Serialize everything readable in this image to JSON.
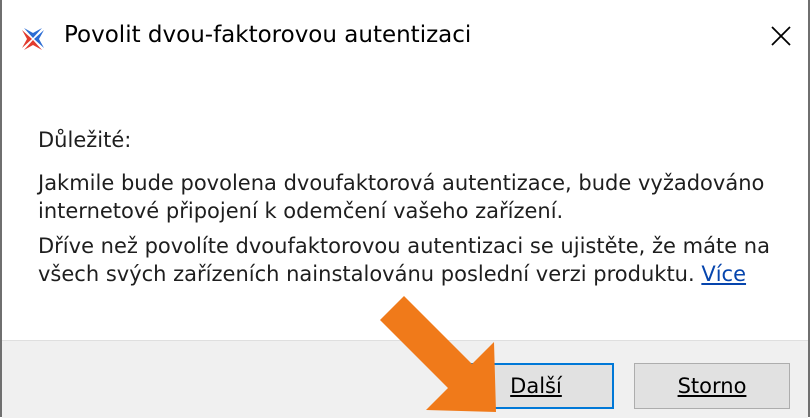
{
  "dialog": {
    "title": "Povolit dvou-faktorovou autentizaci",
    "app_icon": "app-logo-icon",
    "close_glyph": "✕"
  },
  "content": {
    "heading": "Důležité:",
    "paragraph1_line1": "Jakmile bude povolena dvoufaktorová autentizace, bude vyžadováno",
    "paragraph1_line2": "internetové připojení k odemčení vašeho zařízení.",
    "paragraph2_line1": "Dříve než povolíte dvoufaktorovou autentizaci se ujistěte, že máte na",
    "paragraph2_line2": "všech svých zařízeních nainstalovánu poslední verzi produktu.",
    "more_link": "Více"
  },
  "buttons": {
    "next_label": "Další",
    "cancel_label": "Storno"
  },
  "annotation": {
    "arrow_color": "#f07a1a",
    "arrow_icon": "pointer-arrow-icon"
  },
  "colors": {
    "focus_border": "#0078d7",
    "link": "#0645ad",
    "footer_bg": "#f0f0f0"
  }
}
